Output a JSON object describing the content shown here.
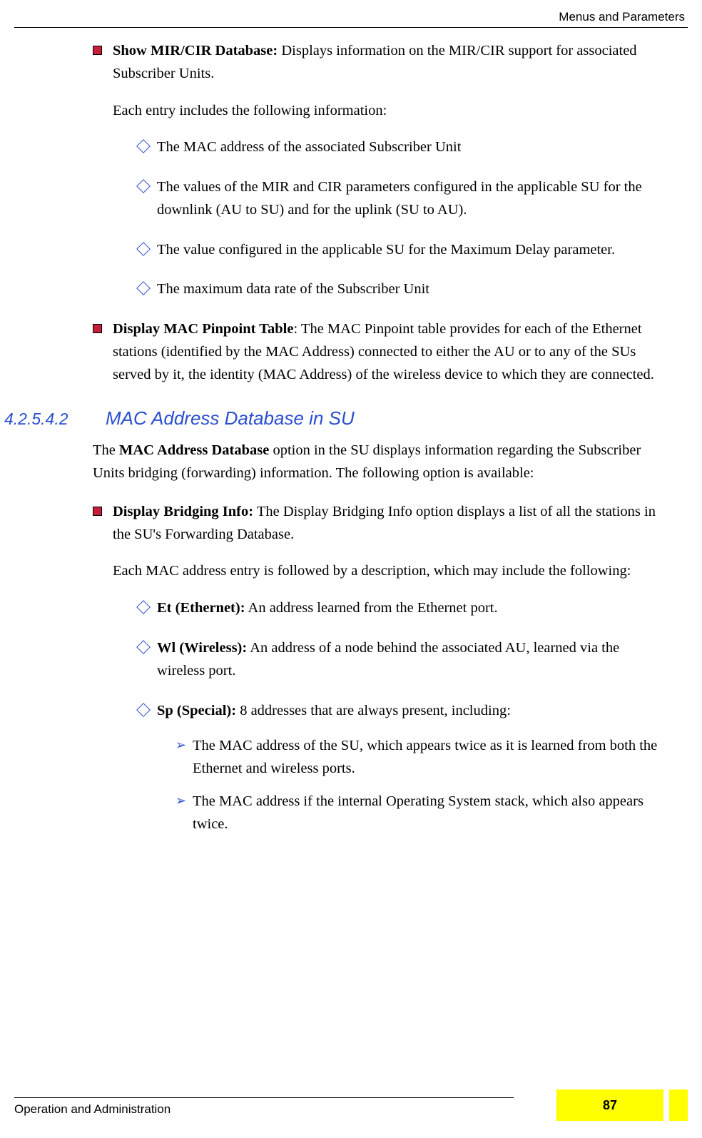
{
  "header": {
    "right": "Menus and Parameters"
  },
  "items": [
    {
      "title": "Show MIR/CIR Database:",
      "body": " Displays information on the MIR/CIR support for associated Subscriber Units.",
      "note": "Each entry includes the following information:",
      "diamonds": [
        {
          "text": "The MAC address of the associated Subscriber Unit"
        },
        {
          "text": "The values of the MIR and CIR parameters configured in the applicable SU for the downlink (AU to SU) and for the uplink (SU to AU)."
        },
        {
          "text": "The value configured in the applicable SU for the Maximum Delay parameter."
        },
        {
          "text": "The maximum data rate of the Subscriber Unit"
        }
      ]
    },
    {
      "title": "Display MAC Pinpoint Table",
      "body": ": The MAC Pinpoint table provides for each of the Ethernet stations (identified by the MAC Address) connected to either the AU or to any of the SUs served by it, the identity (MAC Address) of the wireless device to which they are connected."
    }
  ],
  "section": {
    "num": "4.2.5.4.2",
    "title": "MAC Address Database in SU"
  },
  "para1_a": "The ",
  "para1_bold": "MAC Address Database",
  "para1_b": " option in the SU displays information regarding the Subscriber Units bridging (forwarding) information. The following option is available:",
  "item3": {
    "title": "Display Bridging Info:",
    "body": " The Display Bridging Info option displays a list of all the stations in the SU's Forwarding Database.",
    "note": "Each MAC address entry is followed by a description, which may include the following:",
    "diamonds": [
      {
        "bold": "Et (Ethernet):",
        "text": " An address learned from the Ethernet port."
      },
      {
        "bold": "Wl (Wireless):",
        "text": " An address of a node behind the associated AU, learned via the wireless port."
      },
      {
        "bold": "Sp (Special):",
        "text": " 8 addresses that are always present, including:",
        "arrows": [
          "The MAC address of the SU, which appears twice as it is learned from both the Ethernet and wireless ports.",
          "The MAC address if the internal Operating System stack, which also appears twice."
        ]
      }
    ]
  },
  "footer": {
    "left": "Operation and Administration",
    "page": "87"
  }
}
